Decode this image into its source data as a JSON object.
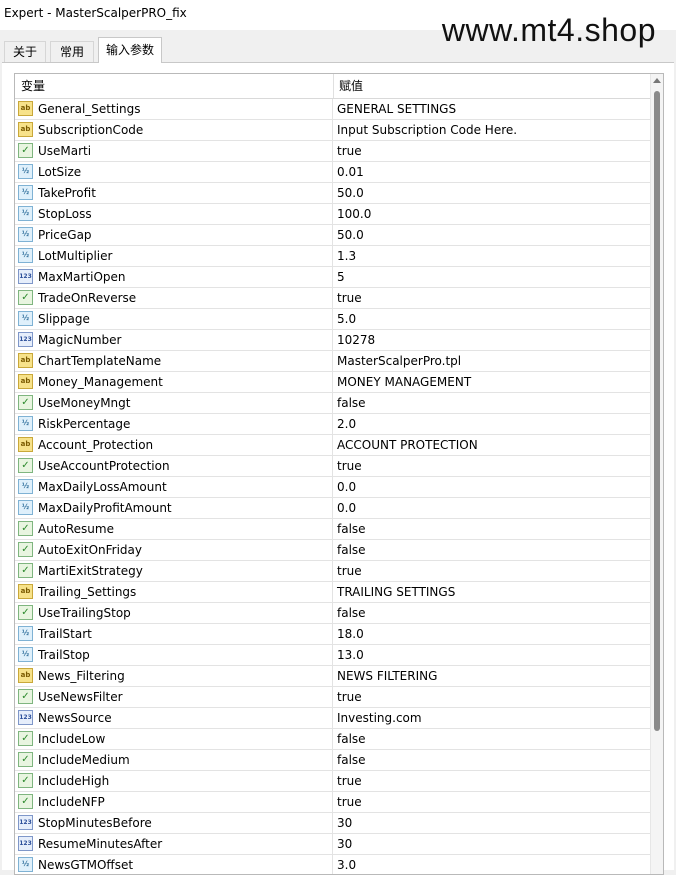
{
  "window": {
    "title": "Expert - MasterScalperPRO_fix",
    "watermark": "www.mt4.shop"
  },
  "tabs": [
    {
      "label": "关于",
      "active": false
    },
    {
      "label": "常用",
      "active": false
    },
    {
      "label": "输入参数",
      "active": true
    }
  ],
  "grid": {
    "header": {
      "name": "变量",
      "value": "赋值"
    },
    "rows": [
      {
        "name": "General_Settings",
        "value": "GENERAL SETTINGS",
        "type": "string"
      },
      {
        "name": "SubscriptionCode",
        "value": "Input Subscription Code Here.",
        "type": "string"
      },
      {
        "name": "UseMarti",
        "value": "true",
        "type": "bool"
      },
      {
        "name": "LotSize",
        "value": "0.01",
        "type": "double"
      },
      {
        "name": "TakeProfit",
        "value": "50.0",
        "type": "double"
      },
      {
        "name": "StopLoss",
        "value": "100.0",
        "type": "double"
      },
      {
        "name": "PriceGap",
        "value": "50.0",
        "type": "double"
      },
      {
        "name": "LotMultiplier",
        "value": "1.3",
        "type": "double"
      },
      {
        "name": "MaxMartiOpen",
        "value": "5",
        "type": "int"
      },
      {
        "name": "TradeOnReverse",
        "value": "true",
        "type": "bool"
      },
      {
        "name": "Slippage",
        "value": "5.0",
        "type": "double"
      },
      {
        "name": "MagicNumber",
        "value": "10278",
        "type": "int"
      },
      {
        "name": "ChartTemplateName",
        "value": "MasterScalperPro.tpl",
        "type": "string"
      },
      {
        "name": "Money_Management",
        "value": "MONEY MANAGEMENT",
        "type": "string"
      },
      {
        "name": "UseMoneyMngt",
        "value": "false",
        "type": "bool"
      },
      {
        "name": "RiskPercentage",
        "value": "2.0",
        "type": "double"
      },
      {
        "name": "Account_Protection",
        "value": "ACCOUNT PROTECTION",
        "type": "string"
      },
      {
        "name": "UseAccountProtection",
        "value": "true",
        "type": "bool"
      },
      {
        "name": "MaxDailyLossAmount",
        "value": "0.0",
        "type": "double"
      },
      {
        "name": "MaxDailyProfitAmount",
        "value": "0.0",
        "type": "double"
      },
      {
        "name": "AutoResume",
        "value": "false",
        "type": "bool"
      },
      {
        "name": "AutoExitOnFriday",
        "value": "false",
        "type": "bool"
      },
      {
        "name": "MartiExitStrategy",
        "value": "true",
        "type": "bool"
      },
      {
        "name": "Trailing_Settings",
        "value": "TRAILING SETTINGS",
        "type": "string"
      },
      {
        "name": "UseTrailingStop",
        "value": "false",
        "type": "bool"
      },
      {
        "name": "TrailStart",
        "value": "18.0",
        "type": "double"
      },
      {
        "name": "TrailStop",
        "value": "13.0",
        "type": "double"
      },
      {
        "name": "News_Filtering",
        "value": "NEWS FILTERING",
        "type": "string"
      },
      {
        "name": "UseNewsFilter",
        "value": "true",
        "type": "bool"
      },
      {
        "name": "NewsSource",
        "value": "Investing.com",
        "type": "int"
      },
      {
        "name": "IncludeLow",
        "value": "false",
        "type": "bool"
      },
      {
        "name": "IncludeMedium",
        "value": "false",
        "type": "bool"
      },
      {
        "name": "IncludeHigh",
        "value": "true",
        "type": "bool"
      },
      {
        "name": "IncludeNFP",
        "value": "true",
        "type": "bool"
      },
      {
        "name": "StopMinutesBefore",
        "value": "30",
        "type": "int"
      },
      {
        "name": "ResumeMinutesAfter",
        "value": "30",
        "type": "int"
      },
      {
        "name": "NewsGTMOffset",
        "value": "3.0",
        "type": "double"
      }
    ]
  },
  "icons": {
    "string": "ab",
    "bool": "✓",
    "double": "½",
    "int": "123"
  }
}
